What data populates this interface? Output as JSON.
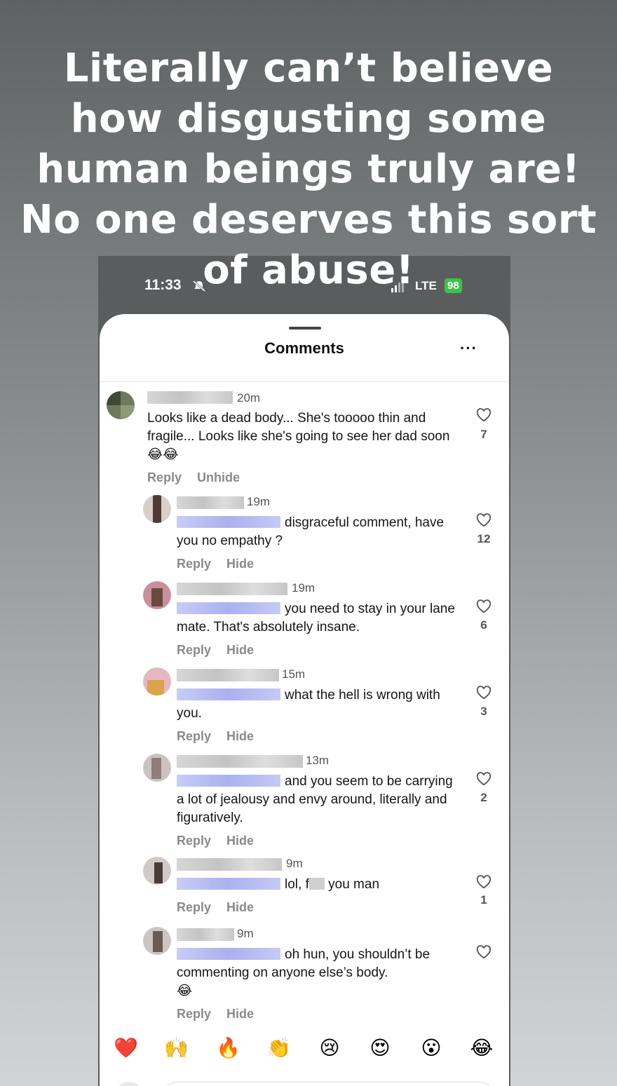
{
  "caption": [
    "Literally can’t believe",
    "how disgusting some",
    "human beings truly are!",
    "No one deserves this sort",
    "of abuse!"
  ],
  "status": {
    "time": "11:33",
    "network": "LTE",
    "battery": "98"
  },
  "header": {
    "title": "Comments",
    "more": "···"
  },
  "comments": [
    {
      "time": "20m",
      "text": "Looks like a dead body... She's tooooo thin and fragile... Looks like she's going to see her dad soon",
      "emoji": "😂😂",
      "likes": "7",
      "actions": [
        "Reply",
        "Unhide"
      ]
    },
    {
      "time": "19m",
      "text": "disgraceful comment, have you no empathy ?",
      "likes": "12",
      "actions": [
        "Reply",
        "Hide"
      ]
    },
    {
      "time": "19m",
      "text": "you need to stay in your lane mate. That's absolutely insane.",
      "likes": "6",
      "actions": [
        "Reply",
        "Hide"
      ]
    },
    {
      "time": "15m",
      "text": "what the hell is wrong with you.",
      "likes": "3",
      "actions": [
        "Reply",
        "Hide"
      ]
    },
    {
      "time": "13m",
      "text": "and you seem to be carrying a lot of jealousy and envy around, literally and figuratively.",
      "likes": "2",
      "actions": [
        "Reply",
        "Hide"
      ]
    },
    {
      "time": "9m",
      "text_before": "lol, f",
      "text_after": " you man",
      "likes": "1",
      "actions": [
        "Reply",
        "Hide"
      ]
    },
    {
      "time": "9m",
      "text": "oh hun, you shouldn’t be commenting on anyone else’s body.",
      "emoji": "😂",
      "likes": "",
      "actions": [
        "Reply",
        "Hide"
      ]
    }
  ],
  "reactions": [
    "❤️",
    "🙌",
    "🔥",
    "👏",
    "😢",
    "😍",
    "😮",
    "😂"
  ],
  "icons": {
    "notifications": "bell-slash-icon",
    "signal": "signal-icon",
    "like": "heart-outline-icon"
  },
  "colors": {
    "battery": "#3cc24a",
    "mention_blur": "#aab1ee"
  }
}
